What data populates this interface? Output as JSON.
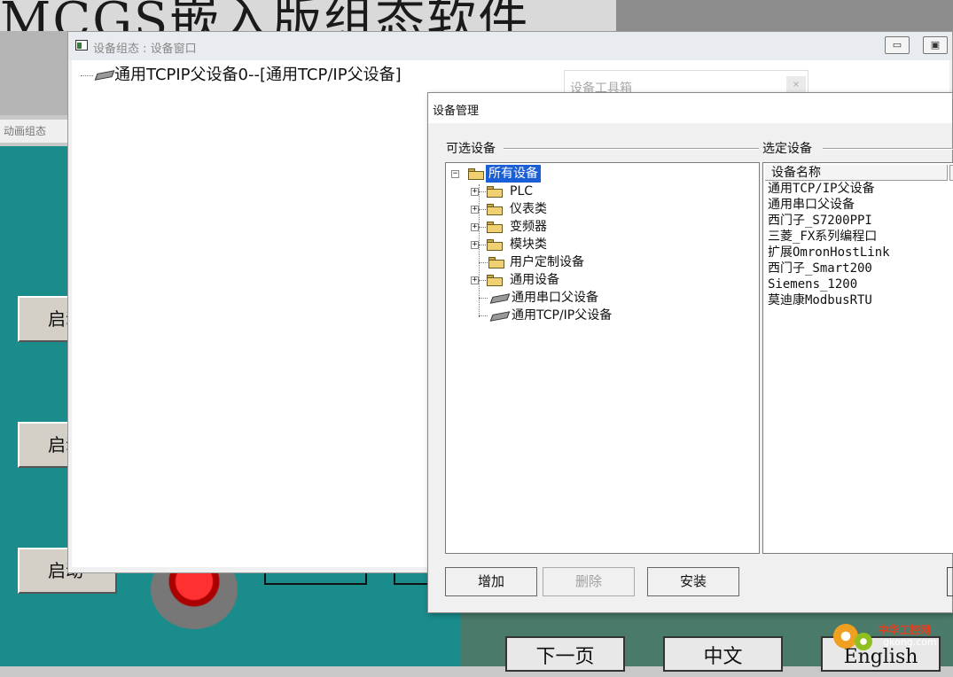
{
  "background_app": {
    "banner_title": "MCGS嵌入版组态软件",
    "animation_tab": "动画组态",
    "start_buttons": [
      "启动",
      "启动",
      "启动"
    ],
    "bottom_buttons": [
      "下一页",
      "中文",
      "English"
    ]
  },
  "device_window": {
    "title": "设备组态 : 设备窗口",
    "tree_root": "通用TCPIP父设备0--[通用TCP/IP父设备]",
    "controls": [
      "▭",
      "▣"
    ]
  },
  "toolbox": {
    "title": "设备工具箱",
    "close_glyph": "×"
  },
  "device_manager": {
    "title": "设备管理",
    "available_label": "可选设备",
    "selected_label": "选定设备",
    "tree": {
      "root": "所有设备",
      "items": [
        {
          "label": "PLC",
          "expandable": true,
          "icon": "folder-icon"
        },
        {
          "label": "仪表类",
          "expandable": true,
          "icon": "folder-icon"
        },
        {
          "label": "变频器",
          "expandable": true,
          "icon": "folder-icon"
        },
        {
          "label": "模块类",
          "expandable": true,
          "icon": "folder-icon"
        },
        {
          "label": "用户定制设备",
          "expandable": false,
          "icon": "folder-icon"
        },
        {
          "label": "通用设备",
          "expandable": true,
          "icon": "folder-icon"
        },
        {
          "label": "通用串口父设备",
          "expandable": false,
          "icon": "device-chip-icon"
        },
        {
          "label": "通用TCP/IP父设备",
          "expandable": false,
          "icon": "device-chip-icon"
        }
      ]
    },
    "selected_header": "设备名称",
    "selected_devices": [
      "通用TCP/IP父设备",
      "通用串口父设备",
      "西门子_S7200PPI",
      "三菱_FX系列编程口",
      "扩展OmronHostLink",
      "西门子_Smart200",
      "Siemens_1200",
      "莫迪康ModbusRTU"
    ],
    "buttons": {
      "add": "增加",
      "delete": "删除",
      "install": "安装"
    }
  },
  "watermark": {
    "name": "中华工控网",
    "url": "gkong.com"
  },
  "colors": {
    "teal_background": "#1a8c8c",
    "selection_blue": "#1a5fd6"
  }
}
